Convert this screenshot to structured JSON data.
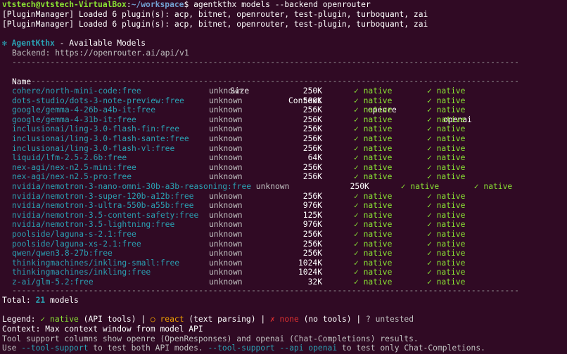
{
  "prompt": {
    "user_host": "vtstech@vtstech-VirtualBox",
    "path": "~/workspace",
    "symbol": "$",
    "command": "agentkthx models --backend openrouter"
  },
  "plugin_lines": [
    "[PluginManager] Loaded 6 plugin(s): acp, bitnet, openrouter, test-plugin, turboquant, zai",
    "[PluginManager] Loaded 6 plugin(s): acp, bitnet, openrouter, test-plugin, turboquant, zai"
  ],
  "header": {
    "icon": "gear-star-icon",
    "icon_glyph": "✻",
    "app_name": "AgentKthx",
    "title_rest": " - Available Models",
    "backend_line": "Backend: https://openrouter.ai/api/v1"
  },
  "rule": "----------------------------------------------------------------------------------------------------------",
  "columns": {
    "name": "Name",
    "size": "Size",
    "context": "Context",
    "openre": "openre",
    "openai": "openai"
  },
  "models": [
    {
      "name": "cohere/north-mini-code:free",
      "size": "unknown",
      "context": "250K",
      "openre": "✓ native",
      "openai": "✓ native"
    },
    {
      "name": "dots-studio/dots-3-note-preview:free",
      "size": "unknown",
      "context": "500K",
      "openre": "✓ native",
      "openai": "✓ native"
    },
    {
      "name": "google/gemma-4-26b-a4b-it:free",
      "size": "unknown",
      "context": "256K",
      "openre": "✓ native",
      "openai": "✓ native"
    },
    {
      "name": "google/gemma-4-31b-it:free",
      "size": "unknown",
      "context": "256K",
      "openre": "✓ native",
      "openai": "✓ native"
    },
    {
      "name": "inclusionai/ling-3.0-flash-fin:free",
      "size": "unknown",
      "context": "256K",
      "openre": "✓ native",
      "openai": "✓ native"
    },
    {
      "name": "inclusionai/ling-3.0-flash-sante:free",
      "size": "unknown",
      "context": "256K",
      "openre": "✓ native",
      "openai": "✓ native"
    },
    {
      "name": "inclusionai/ling-3.0-flash-vl:free",
      "size": "unknown",
      "context": "256K",
      "openre": "✓ native",
      "openai": "✓ native"
    },
    {
      "name": "liquid/lfm-2.5-2.6b:free",
      "size": "unknown",
      "context": "64K",
      "openre": "✓ native",
      "openai": "✓ native"
    },
    {
      "name": "nex-agi/nex-n2.5-mini:free",
      "size": "unknown",
      "context": "256K",
      "openre": "✓ native",
      "openai": "✓ native"
    },
    {
      "name": "nex-agi/nex-n2.5-pro:free",
      "size": "unknown",
      "context": "256K",
      "openre": "✓ native",
      "openai": "✓ native"
    },
    {
      "name": "nvidia/nemotron-3-nano-omni-30b-a3b-reasoning:free",
      "size": "unknown",
      "context": "250K",
      "openre": "✓ native",
      "openai": "✓ native"
    },
    {
      "name": "nvidia/nemotron-3-super-120b-a12b:free",
      "size": "unknown",
      "context": "256K",
      "openre": "✓ native",
      "openai": "✓ native"
    },
    {
      "name": "nvidia/nemotron-3-ultra-550b-a55b:free",
      "size": "unknown",
      "context": "976K",
      "openre": "✓ native",
      "openai": "✓ native"
    },
    {
      "name": "nvidia/nemotron-3.5-content-safety:free",
      "size": "unknown",
      "context": "125K",
      "openre": "✓ native",
      "openai": "✓ native"
    },
    {
      "name": "nvidia/nemotron-3.5-lightning:free",
      "size": "unknown",
      "context": "976K",
      "openre": "✓ native",
      "openai": "✓ native"
    },
    {
      "name": "poolside/laguna-s-2.1:free",
      "size": "unknown",
      "context": "256K",
      "openre": "✓ native",
      "openai": "✓ native"
    },
    {
      "name": "poolside/laguna-xs-2.1:free",
      "size": "unknown",
      "context": "256K",
      "openre": "✓ native",
      "openai": "✓ native"
    },
    {
      "name": "qwen/qwen3.8-27b:free",
      "size": "unknown",
      "context": "256K",
      "openre": "✓ native",
      "openai": "✓ native"
    },
    {
      "name": "thinkingmachines/inkling-small:free",
      "size": "unknown",
      "context": "1024K",
      "openre": "✓ native",
      "openai": "✓ native"
    },
    {
      "name": "thinkingmachines/inkling:free",
      "size": "unknown",
      "context": "1024K",
      "openre": "✓ native",
      "openai": "✓ native"
    },
    {
      "name": "z-ai/glm-5.2:free",
      "size": "unknown",
      "context": "32K",
      "openre": "✓ native",
      "openai": "✓ native"
    }
  ],
  "total": {
    "label": "Total:",
    "count": "21",
    "unit": "models"
  },
  "legend": {
    "label": "Legend:",
    "native": "✓ native",
    "native_desc": "(API tools) |",
    "react": "○ react",
    "react_desc": "(text parsing) |",
    "none": "✗ none",
    "none_desc": "(no tools) |",
    "untested": "? untested"
  },
  "context_note": "Context: Max context window from model API",
  "tool_support_note": "Tool support columns show openre (OpenResponses) and openai (Chat-Completions) results.",
  "usage": {
    "pre": "Use ",
    "flag1": "--tool-support",
    "mid": " to test both API modes. ",
    "flag2": "--tool-support --api openai",
    "post": " to test only Chat-Completions."
  }
}
